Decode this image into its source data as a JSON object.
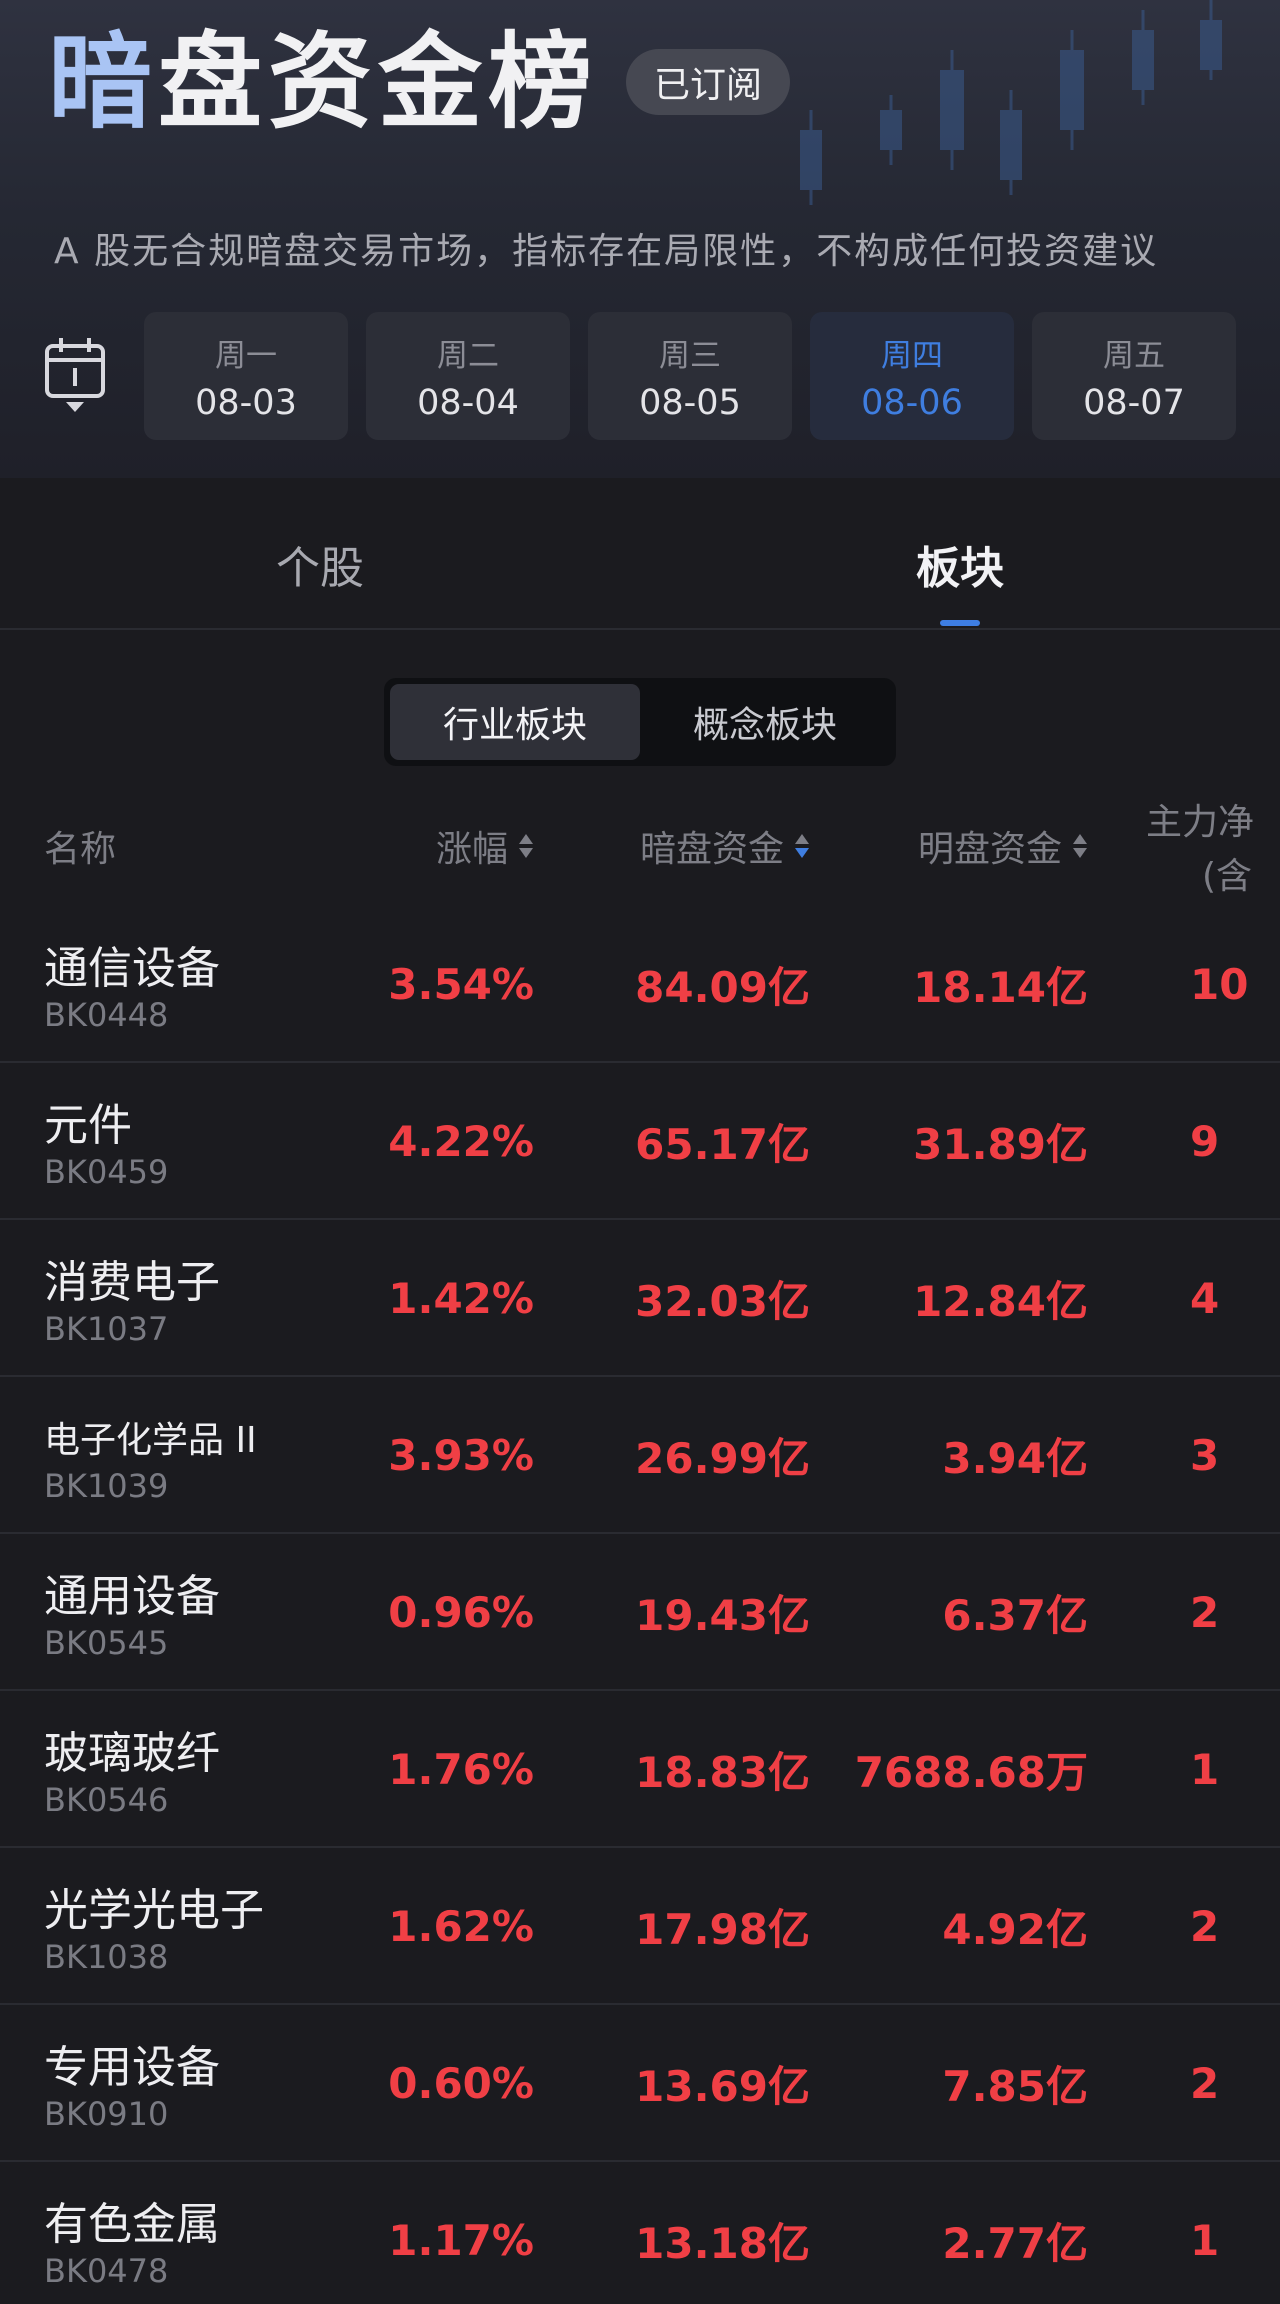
{
  "header": {
    "title": "暗盘资金榜",
    "subscribe_label": "已订阅",
    "disclaimer": "A 股无合规暗盘交易市场，指标存在局限性，不构成任何投资建议"
  },
  "days": [
    {
      "weekday": "周一",
      "date": "08-03",
      "active": false
    },
    {
      "weekday": "周二",
      "date": "08-04",
      "active": false
    },
    {
      "weekday": "周三",
      "date": "08-05",
      "active": false
    },
    {
      "weekday": "周四",
      "date": "08-06",
      "active": true
    },
    {
      "weekday": "周五",
      "date": "08-07",
      "active": false
    }
  ],
  "tabs": {
    "stock": "个股",
    "sector": "板块",
    "active": "sector"
  },
  "segment": {
    "industry": "行业板块",
    "concept": "概念板块",
    "active": "industry"
  },
  "columns": {
    "name": "名称",
    "change": "涨幅",
    "dark_fund": "暗盘资金",
    "open_fund": "明盘资金",
    "main_fund_line1": "主力净",
    "main_fund_line2": "(含"
  },
  "rows": [
    {
      "name": "通信设备",
      "code": "BK0448",
      "change": "3.54%",
      "dark": "84.09亿",
      "open": "18.14亿",
      "main": "10"
    },
    {
      "name": "元件",
      "code": "BK0459",
      "change": "4.22%",
      "dark": "65.17亿",
      "open": "31.89亿",
      "main": "9"
    },
    {
      "name": "消费电子",
      "code": "BK1037",
      "change": "1.42%",
      "dark": "32.03亿",
      "open": "12.84亿",
      "main": "4"
    },
    {
      "name": "电子化学品 II",
      "code": "BK1039",
      "change": "3.93%",
      "dark": "26.99亿",
      "open": "3.94亿",
      "main": "3"
    },
    {
      "name": "通用设备",
      "code": "BK0545",
      "change": "0.96%",
      "dark": "19.43亿",
      "open": "6.37亿",
      "main": "2"
    },
    {
      "name": "玻璃玻纤",
      "code": "BK0546",
      "change": "1.76%",
      "dark": "18.83亿",
      "open": "7688.68万",
      "main": "1"
    },
    {
      "name": "光学光电子",
      "code": "BK1038",
      "change": "1.62%",
      "dark": "17.98亿",
      "open": "4.92亿",
      "main": "2"
    },
    {
      "name": "专用设备",
      "code": "BK0910",
      "change": "0.60%",
      "dark": "13.69亿",
      "open": "7.85亿",
      "main": "2"
    },
    {
      "name": "有色金属",
      "code": "BK0478",
      "change": "1.17%",
      "dark": "13.18亿",
      "open": "2.77亿",
      "main": "1"
    }
  ],
  "colors": {
    "up": "#f03f45",
    "accent": "#3f7ee0"
  }
}
